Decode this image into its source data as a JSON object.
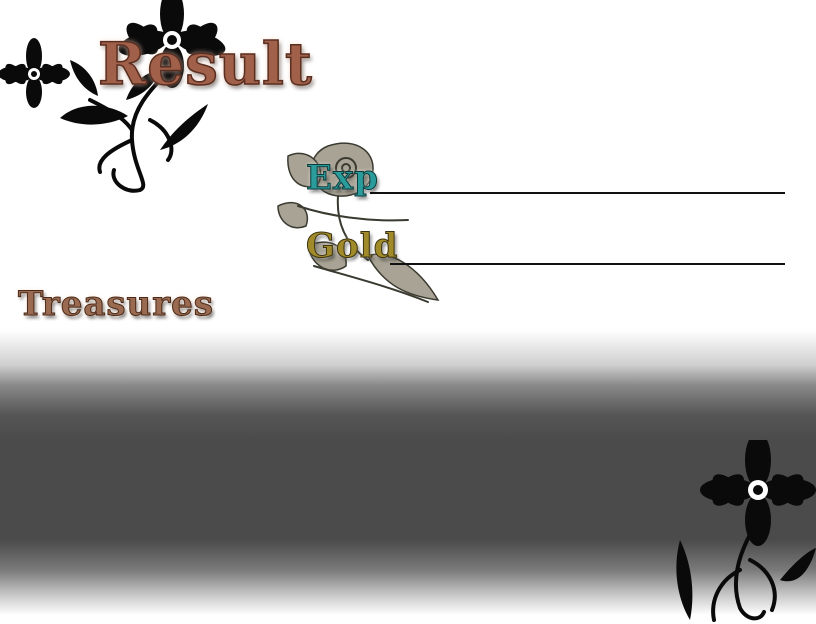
{
  "screen": {
    "title": "Result",
    "treasures_label": "Treasures",
    "exp_label": "Exp",
    "gold_label": "Gold",
    "exp_value": "",
    "gold_value": "",
    "treasures": []
  },
  "icons": {
    "top_left_ornament": "floral-ornament-icon",
    "center_ornament": "paisley-ornament-icon",
    "bottom_right_ornament": "floral-ornament-icon"
  },
  "colors": {
    "result_title": "#a0604a",
    "treasures_title": "#9a6b50",
    "exp_label": "#2a9c9c",
    "gold_label": "#a08a2a",
    "band_dark": "#4b4b4b"
  }
}
